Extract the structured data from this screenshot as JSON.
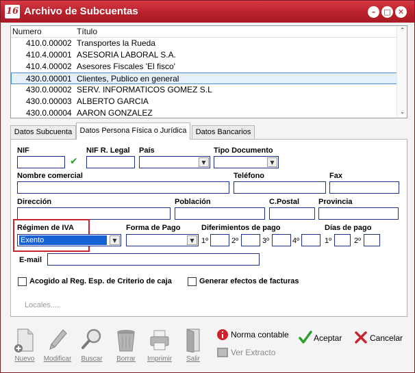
{
  "window": {
    "title": "Archivo de Subcuentas",
    "app_icon_text": "16"
  },
  "list": {
    "col_numero": "Numero",
    "col_titulo": "Título",
    "rows": [
      {
        "numero": "410.0.00002",
        "titulo": "Transportes la Rueda"
      },
      {
        "numero": "410.4.00001",
        "titulo": "ASESORIA LABORAL S.A."
      },
      {
        "numero": "410.4.00002",
        "titulo": "Asesores Fiscales 'El fisco'"
      },
      {
        "numero": "430.0.00001",
        "titulo": "Clientes, Publico en general"
      },
      {
        "numero": "430.0.00002",
        "titulo": "SERV. INFORMATICOS GOMEZ S.L"
      },
      {
        "numero": "430.0.00003",
        "titulo": "ALBERTO GARCIA"
      },
      {
        "numero": "430.0.00004",
        "titulo": "AARON GONZALEZ"
      }
    ],
    "selected_index": 3
  },
  "tabs": [
    {
      "label": "Datos Subcuenta"
    },
    {
      "label": "Datos Persona Física o Jurídica"
    },
    {
      "label": "Datos Bancarios"
    }
  ],
  "active_tab": 1,
  "form": {
    "nif": {
      "label": "NIF",
      "value": ""
    },
    "nif_legal": {
      "label": "NIF R. Legal",
      "value": ""
    },
    "pais": {
      "label": "País",
      "value": ""
    },
    "tipo_documento": {
      "label": "Tipo Documento",
      "value": ""
    },
    "nombre_comercial": {
      "label": "Nombre comercial",
      "value": ""
    },
    "telefono": {
      "label": "Teléfono",
      "value": ""
    },
    "fax": {
      "label": "Fax",
      "value": ""
    },
    "direccion": {
      "label": "Dirección",
      "value": ""
    },
    "poblacion": {
      "label": "Población",
      "value": ""
    },
    "cpostal": {
      "label": "C.Postal",
      "value": ""
    },
    "provincia": {
      "label": "Provincia",
      "value": ""
    },
    "regimen_iva": {
      "label": "Régimen de IVA",
      "value": "Exento"
    },
    "forma_pago": {
      "label": "Forma de Pago",
      "value": ""
    },
    "diferimientos": {
      "label": "Diferimientos de pago",
      "ordinals": [
        "1º",
        "2º",
        "3º",
        "4º"
      ]
    },
    "dias_pago": {
      "label": "Días de pago",
      "ordinals": [
        "1º",
        "2º"
      ]
    },
    "email": {
      "label": "E-mail",
      "value": ""
    },
    "checkbox_criterio_caja": {
      "label": "Acogido al Reg. Esp. de Criterio de caja",
      "checked": false
    },
    "checkbox_generar_efectos": {
      "label": "Generar efectos de facturas",
      "checked": false
    },
    "locales_link": "Locales....."
  },
  "toolbar": {
    "nuevo": "Nuevo",
    "modificar": "Modificar",
    "buscar": "Buscar",
    "borrar": "Borrar",
    "imprimir": "Imprimir",
    "salir": "Salir",
    "norma_contable": "Norma contable",
    "ver_extracto": "Ver Extracto",
    "aceptar": "Aceptar",
    "cancelar": "Cancelar"
  },
  "colors": {
    "titlebar": "#b8202b",
    "field_border": "#1c2e8c",
    "selection": "#1662d4",
    "highlight_box": "#c8232f",
    "accept_check": "#2aa22a",
    "cancel_x": "#c8232f"
  },
  "icons": [
    "app-logo-icon",
    "minimize-icon",
    "maximize-icon",
    "close-icon",
    "valid-check-icon",
    "chevron-down-icon",
    "new-document-icon",
    "pencil-icon",
    "magnifier-icon",
    "trash-icon",
    "printer-icon",
    "exit-door-icon",
    "info-icon",
    "extract-icon",
    "accept-check-icon",
    "cancel-x-icon"
  ]
}
